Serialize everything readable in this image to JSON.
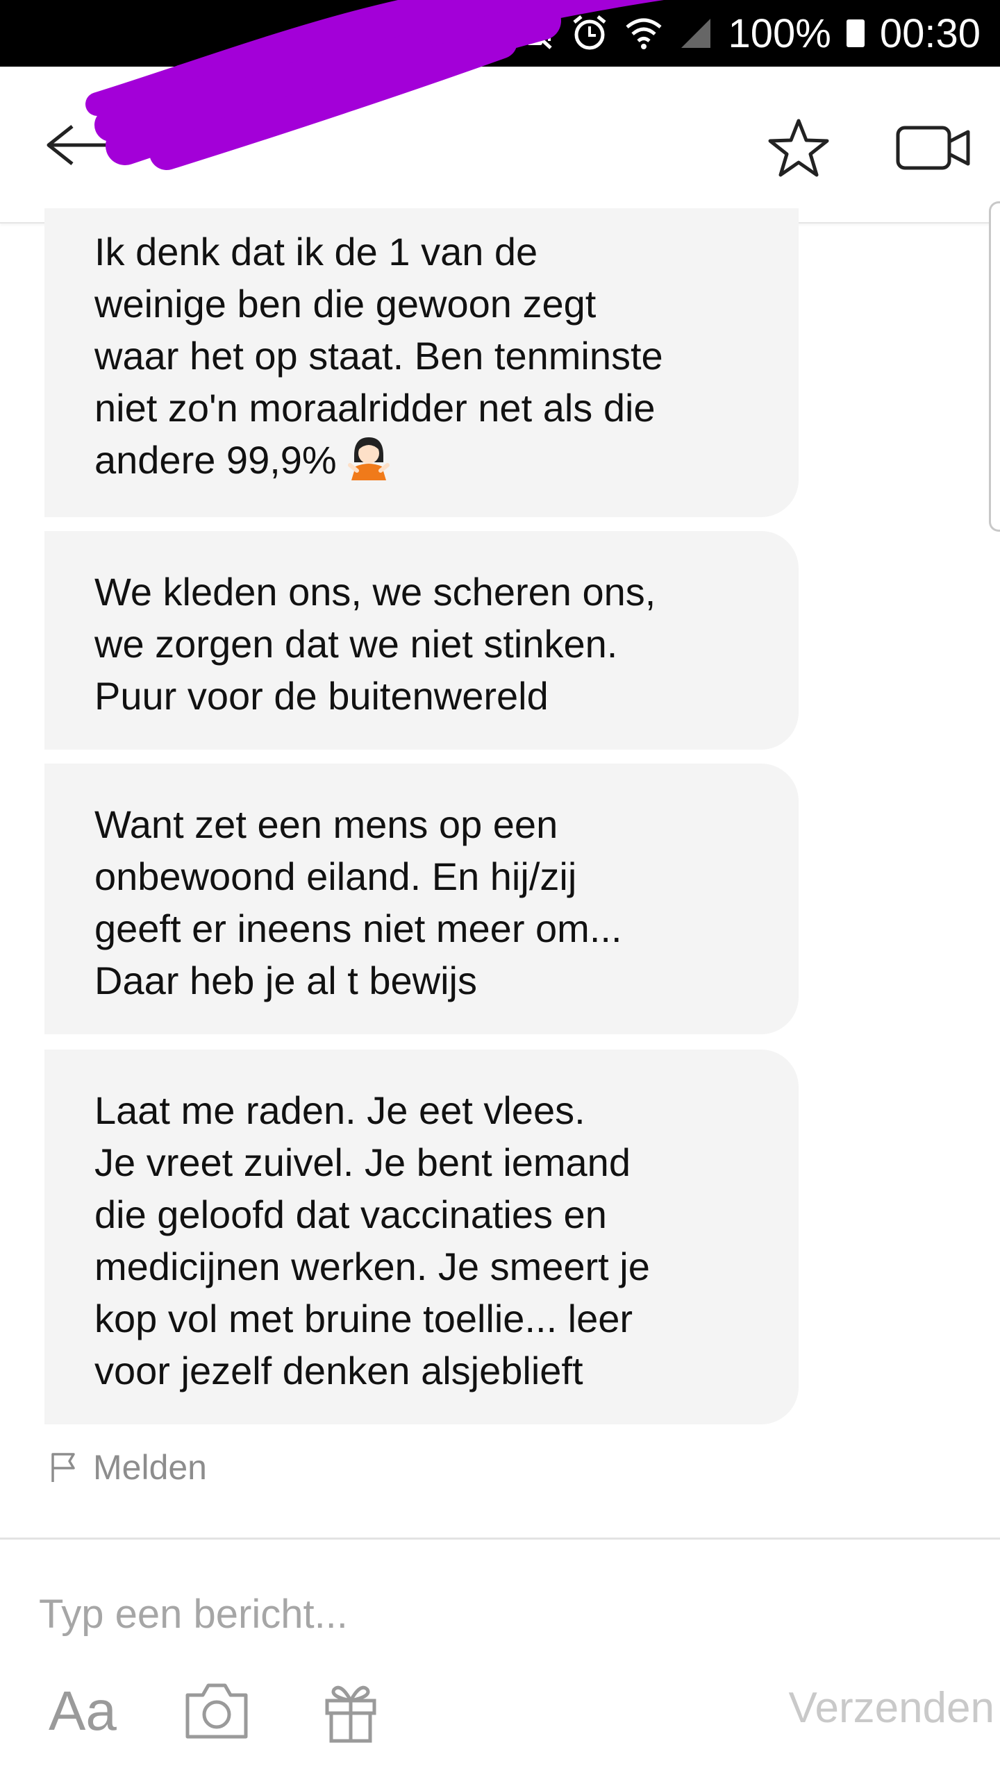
{
  "status_bar": {
    "battery": "100%",
    "time": "00:30"
  },
  "header": {
    "back_icon": "arrow-left-icon",
    "favorite_icon": "star-outline-icon",
    "video_icon": "video-camera-icon",
    "redaction_color": "#a300d8"
  },
  "messages": [
    {
      "text": "Ik denk dat ik de 1 van de\nweinige ben die gewoon zegt\nwaar het op staat. Ben tenminste\nniet zo'n moraalridder net als die\nandere 99,9% ",
      "emoji": "woman-shrugging-emoji"
    },
    {
      "text": "We kleden ons, we scheren ons,\nwe zorgen dat we niet stinken.\nPuur voor de buitenwereld"
    },
    {
      "text": "Want zet een mens op een\nonbewoond eiland. En hij/zij\ngeeft er ineens niet meer om...\nDaar heb je al t bewijs"
    },
    {
      "text": "Laat me raden. Je eet vlees.\nJe vreet zuivel. Je bent iemand\ndie geloofd dat vaccinaties en\nmedicijnen werken. Je smeert je\nkop vol met bruine toellie... leer\nvoor jezelf denken alsjeblieft"
    }
  ],
  "report": {
    "label": "Melden",
    "icon": "flag-outline-icon"
  },
  "composer": {
    "placeholder": "Typ een bericht...",
    "text_format_label": "Aa",
    "camera_icon": "camera-icon",
    "gift_icon": "gift-icon",
    "send_label": "Verzenden"
  },
  "colors": {
    "bubble_bg": "#f4f4f4",
    "muted_text": "#8d8d8d",
    "send_disabled": "#c9c9c9"
  }
}
